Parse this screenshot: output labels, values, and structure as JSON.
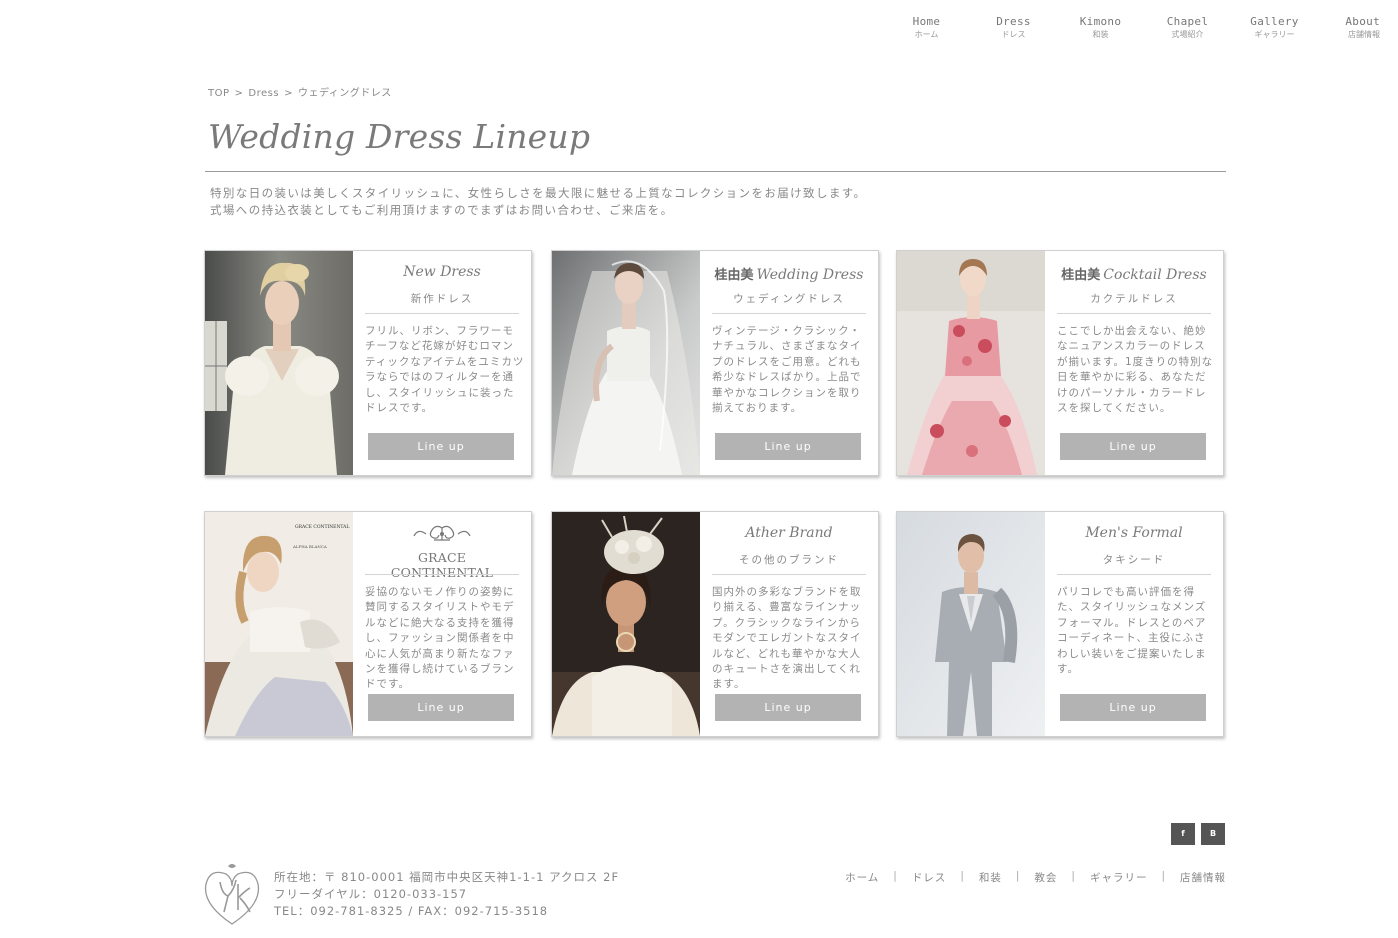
{
  "nav": [
    {
      "en": "Home",
      "jp": "ホーム"
    },
    {
      "en": "Dress",
      "jp": "ドレス"
    },
    {
      "en": "Kimono",
      "jp": "和装"
    },
    {
      "en": "Chapel",
      "jp": "式場紹介"
    },
    {
      "en": "Gallery",
      "jp": "ギャラリー"
    },
    {
      "en": "About",
      "jp": "店舗情報"
    }
  ],
  "breadcrumb": {
    "top": "TOP",
    "dress": "Dress",
    "current": "ウェディングドレス",
    "sep": ">"
  },
  "page": {
    "title": "Wedding Dress Lineup",
    "intro1": "特別な日の装いは美しくスタイリッシュに、女性らしさを最大限に魅せる上質なコレクションをお届け致します。",
    "intro2": "式場への持込衣装としてもご利用頂けますのでまずはお問い合わせ、ご来店を。"
  },
  "cards": [
    {
      "kanji": "",
      "title": "New Dress",
      "sub": "新作ドレス",
      "desc": "フリル、リボン、フラワーモチーフなど花嫁が好むロマンティックなアイテムをユミカツラならではのフィルターを通し、スタイリッシュに装ったドレスです。",
      "button": "Line up"
    },
    {
      "kanji": "桂由美",
      "title": "Wedding Dress",
      "sub": "ウェディングドレス",
      "desc": "ヴィンテージ・クラシック・ナチュラル、さまざまなタイプのドレスをご用意。どれも希少なドレスばかり。上品で華やかなコレクションを取り揃えております。",
      "button": "Line up"
    },
    {
      "kanji": "桂由美",
      "title": "Cocktail Dress",
      "sub": "カクテルドレス",
      "desc": "ここでしか出会えない、絶妙なニュアンスカラーのドレスが揃います。1度きりの特別な日を華やかに彩る、あなただけのパーソナル・カラードレスを探してください。",
      "button": "Line up"
    },
    {
      "kanji": "",
      "title": "GRACE CONTINENTAL",
      "sub": "",
      "desc": "妥協のないモノ作りの姿勢に賛同するスタイリストやモデルなどに絶大なる支持を獲得し、ファッション関係者を中心に人気が高まり新たなファンを獲得し続けているブランドです。",
      "button": "Line up"
    },
    {
      "kanji": "",
      "title": "Ather Brand",
      "sub": "その他のブランド",
      "desc": "国内外の多彩なブランドを取り揃える、豊富なラインナップ。クラシックなラインからモダンでエレガントなスタイルなど、どれも華やかな大人のキュートさを演出してくれます。",
      "button": "Line up"
    },
    {
      "kanji": "",
      "title": "Men's Formal",
      "sub": "タキシード",
      "desc": "パリコレでも高い評価を得た、スタイリッシュなメンズフォーマル。ドレスとのペアコーディネート、主役にふさわしい装いをご提案いたします。",
      "button": "Line up"
    }
  ],
  "photo_text": {
    "brand_small": "GRACE CONTINENTAL",
    "brand_small2": "ALPHA BLANCA"
  },
  "social": {
    "facebook": "f",
    "hatena": "B"
  },
  "footer": {
    "address": "所在地：〒 810-0001 福岡市中央区天神1-1-1 アクロス 2F",
    "freedial": "フリーダイヤル：0120-033-157",
    "tel": "TEL：092-781-8325 / FAX：092-715-3518",
    "links": [
      "ホーム",
      "ドレス",
      "和装",
      "教会",
      "ギャラリー",
      "店舗情報"
    ],
    "sep": "|"
  },
  "colors": {
    "button": "#b3b3b3",
    "text": "#888888",
    "rule": "#9a9a9a",
    "social_bg": "#555555"
  }
}
